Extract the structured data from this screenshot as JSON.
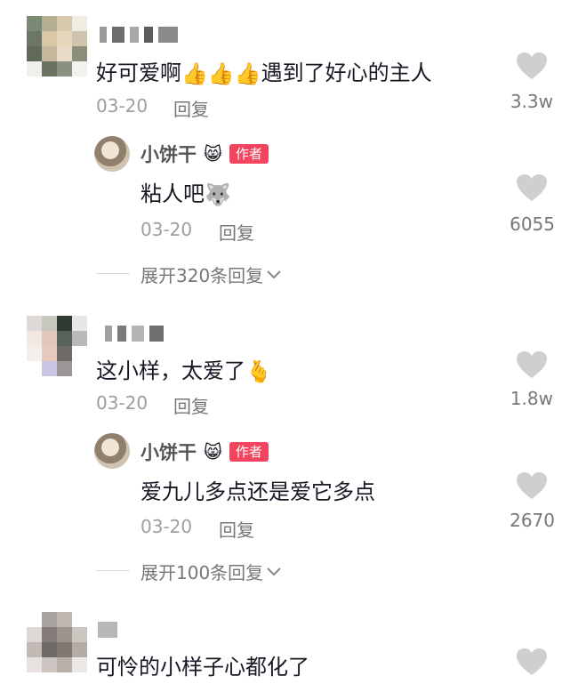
{
  "comments": [
    {
      "text_prefix": "好可爱啊",
      "emoji_thumbs": "👍👍👍",
      "text_suffix": "遇到了好心的主人",
      "date": "03-20",
      "reply_label": "回复",
      "likes": "3.3w",
      "reply": {
        "name": "小饼干",
        "name_emoji": "😸",
        "badge": "作者",
        "text": "粘人吧",
        "emoji": "🐺",
        "date": "03-20",
        "reply_label": "回复",
        "likes": "6055"
      },
      "expand": "展开320条回复"
    },
    {
      "text_prefix": "这小样，太爱了",
      "emoji": "🫰",
      "date": "03-20",
      "reply_label": "回复",
      "likes": "1.8w",
      "reply": {
        "name": "小饼干",
        "name_emoji": "😸",
        "badge": "作者",
        "text": "爱九儿多点还是爱它多点",
        "date": "03-20",
        "reply_label": "回复",
        "likes": "2670"
      },
      "expand": "展开100条回复"
    },
    {
      "text_prefix": "可怜的小样子心都化了"
    }
  ],
  "icons": {
    "like": "heart-icon",
    "expand": "chevron-down-icon"
  },
  "colors": {
    "author_badge": "#f2435f",
    "heart": "#cfcfcf",
    "meta_text": "#9e9e9e"
  }
}
